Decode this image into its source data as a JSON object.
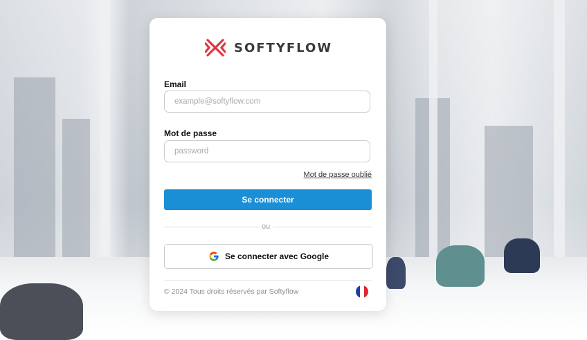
{
  "brand": {
    "name": "SOFTYFLOW",
    "icon": "softyflow-x-logo",
    "color": "#e5333f"
  },
  "form": {
    "email_label": "Email",
    "email_placeholder": "example@softyflow.com",
    "email_value": "",
    "password_label": "Mot de passe",
    "password_placeholder": "password",
    "password_value": "",
    "forgot_link": "Mot de passe oublié",
    "submit_label": "Se connecter",
    "divider_text": "ou",
    "google_label": "Se connecter avec Google",
    "google_icon": "google-icon"
  },
  "footer": {
    "copyright": "© 2024 Tous droits réservés par Softyflow",
    "language_icon": "france-flag-icon"
  },
  "colors": {
    "primary": "#1b8fd6",
    "brand": "#e5333f"
  }
}
